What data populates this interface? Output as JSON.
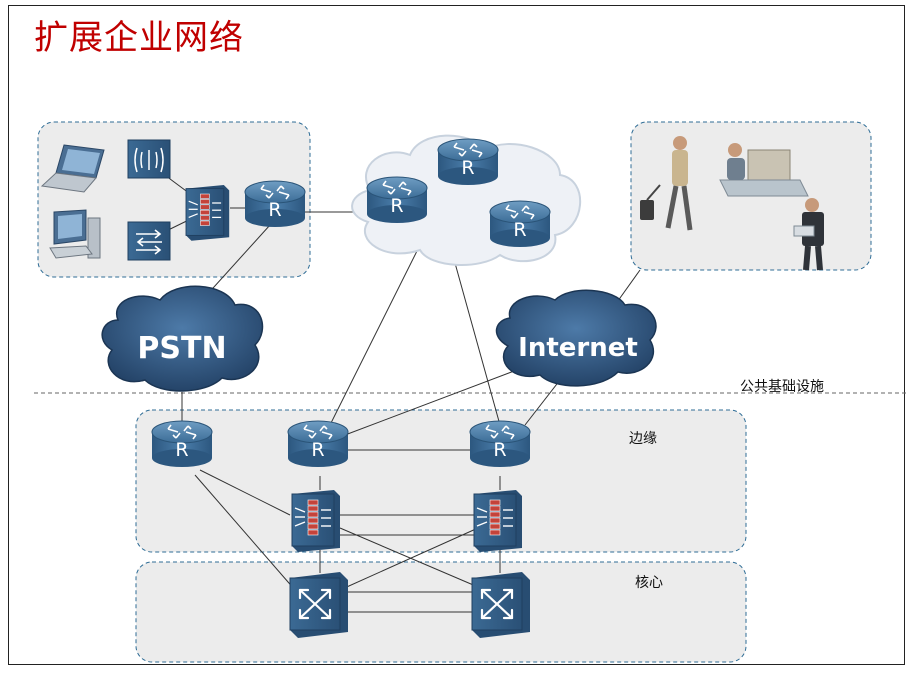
{
  "page": {
    "title": "扩展企业网络"
  },
  "labels": {
    "public_infra": "公共基础设施",
    "edge": "边缘",
    "core": "核心"
  },
  "clouds": {
    "pstn": "PSTN",
    "internet": "Internet"
  },
  "router_letter": "R",
  "colors": {
    "title": "#c00000",
    "zone_fill": "#ececec",
    "zone_border": "#2f6d96",
    "cloud_fill": "#eef1f6",
    "cloud_dark": "#25476e",
    "device": "#3a6a93"
  }
}
